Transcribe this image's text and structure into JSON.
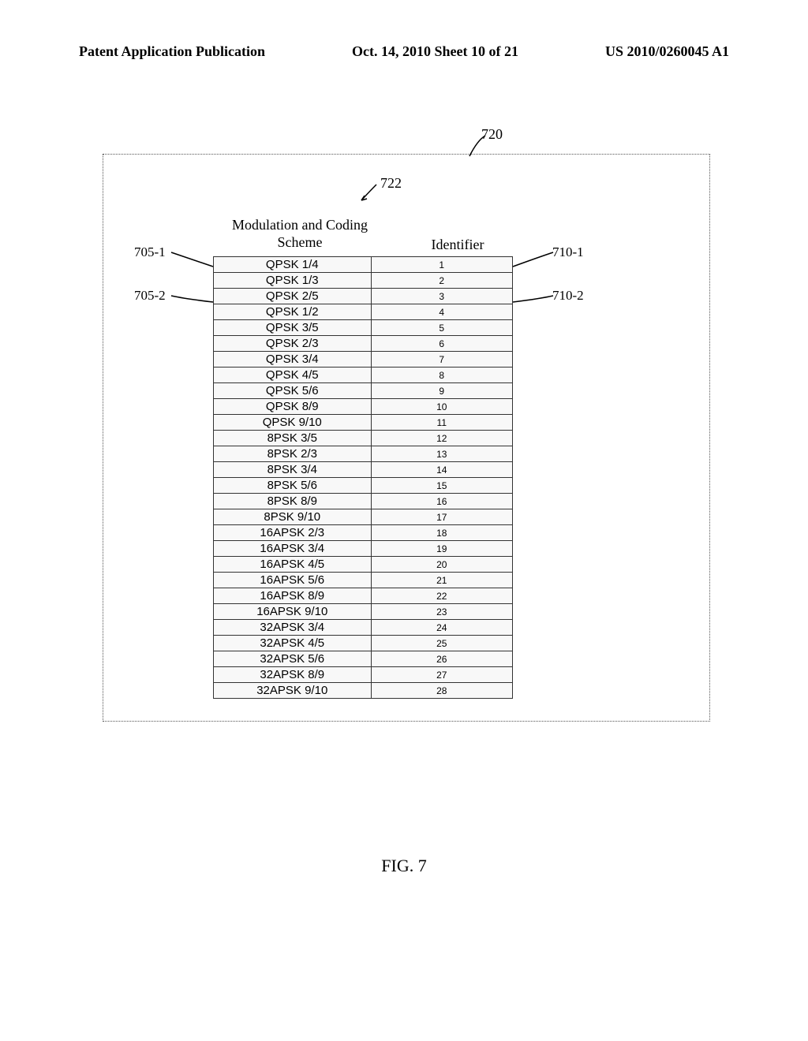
{
  "header": {
    "left": "Patent Application Publication",
    "center": "Oct. 14, 2010  Sheet 10 of 21",
    "right": "US 2010/0260045 A1"
  },
  "figure": {
    "label": "FIG. 7",
    "ref_720": "720",
    "ref_722": "722",
    "ref_705_1": "705-1",
    "ref_705_2": "705-2",
    "ref_710_1": "710-1",
    "ref_710_2": "710-2",
    "mcs_header": "Modulation and Coding Scheme",
    "id_header": "Identifier"
  },
  "chart_data": {
    "type": "table",
    "title": "Modulation and Coding Scheme Identifier Table",
    "columns": [
      "Modulation and Coding Scheme",
      "Identifier"
    ],
    "rows": [
      {
        "mcs": "QPSK 1/4",
        "id": "1"
      },
      {
        "mcs": "QPSK 1/3",
        "id": "2"
      },
      {
        "mcs": "QPSK 2/5",
        "id": "3"
      },
      {
        "mcs": "QPSK 1/2",
        "id": "4"
      },
      {
        "mcs": "QPSK 3/5",
        "id": "5"
      },
      {
        "mcs": "QPSK 2/3",
        "id": "6"
      },
      {
        "mcs": "QPSK 3/4",
        "id": "7"
      },
      {
        "mcs": "QPSK 4/5",
        "id": "8"
      },
      {
        "mcs": "QPSK 5/6",
        "id": "9"
      },
      {
        "mcs": "QPSK 8/9",
        "id": "10"
      },
      {
        "mcs": "QPSK 9/10",
        "id": "11"
      },
      {
        "mcs": "8PSK 3/5",
        "id": "12"
      },
      {
        "mcs": "8PSK 2/3",
        "id": "13"
      },
      {
        "mcs": "8PSK 3/4",
        "id": "14"
      },
      {
        "mcs": "8PSK 5/6",
        "id": "15"
      },
      {
        "mcs": "8PSK 8/9",
        "id": "16"
      },
      {
        "mcs": "8PSK 9/10",
        "id": "17"
      },
      {
        "mcs": "16APSK 2/3",
        "id": "18"
      },
      {
        "mcs": "16APSK 3/4",
        "id": "19"
      },
      {
        "mcs": "16APSK 4/5",
        "id": "20"
      },
      {
        "mcs": "16APSK 5/6",
        "id": "21"
      },
      {
        "mcs": "16APSK 8/9",
        "id": "22"
      },
      {
        "mcs": "16APSK 9/10",
        "id": "23"
      },
      {
        "mcs": "32APSK 3/4",
        "id": "24"
      },
      {
        "mcs": "32APSK 4/5",
        "id": "25"
      },
      {
        "mcs": "32APSK 5/6",
        "id": "26"
      },
      {
        "mcs": "32APSK 8/9",
        "id": "27"
      },
      {
        "mcs": "32APSK 9/10",
        "id": "28"
      }
    ]
  }
}
